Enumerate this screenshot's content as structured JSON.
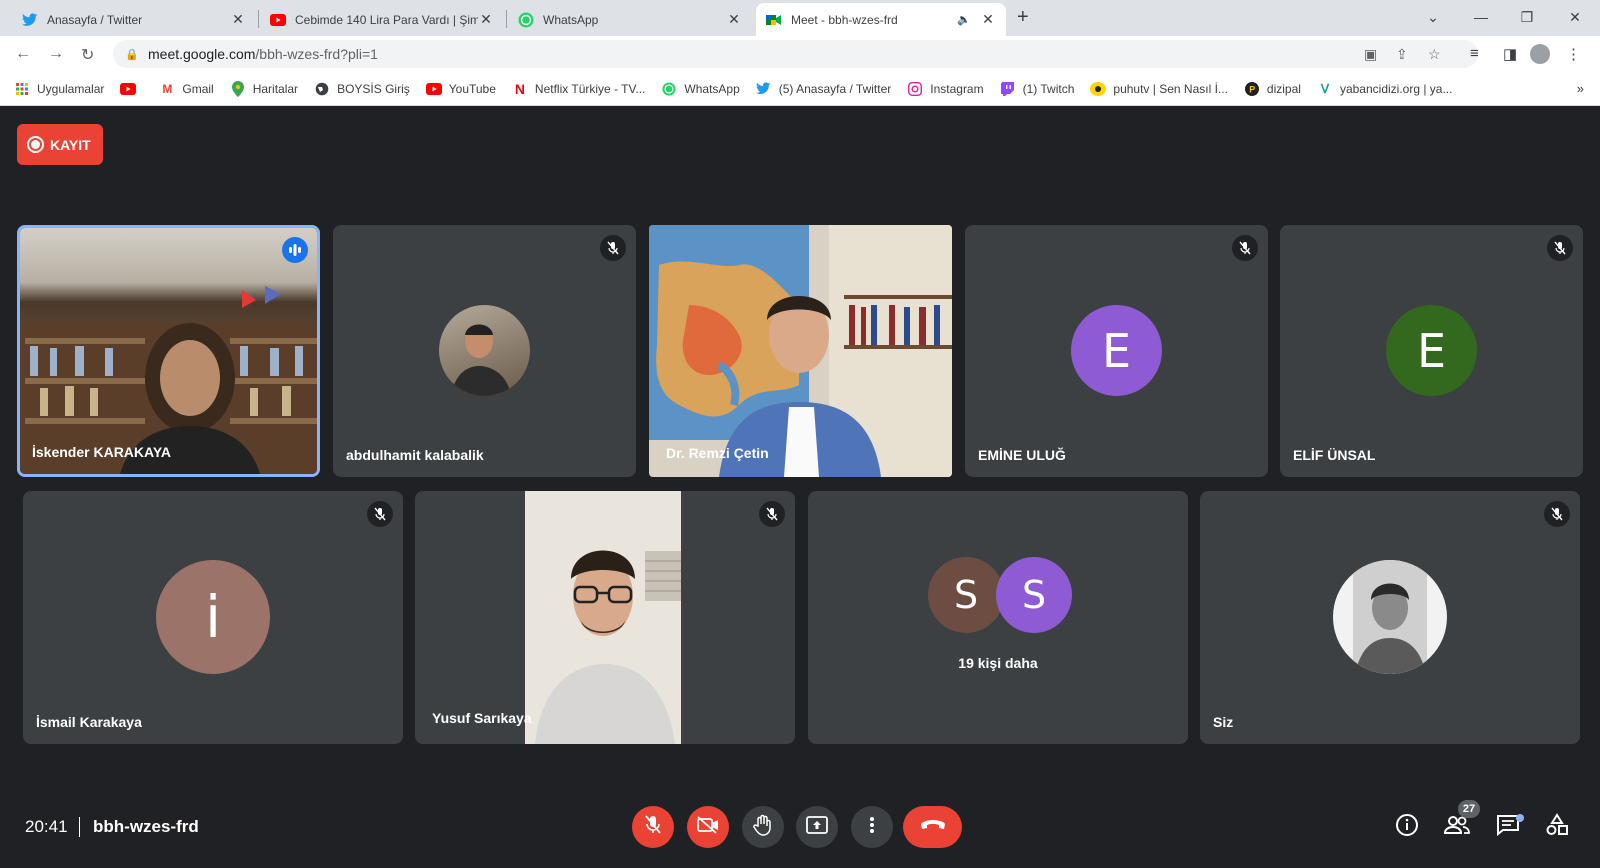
{
  "browser": {
    "tabs": [
      {
        "title": "Anasayfa / Twitter",
        "icon": "twitter-icon",
        "active": false
      },
      {
        "title": "Cebimde 140 Lira Para Vardı | Şim",
        "icon": "youtube-icon",
        "active": false
      },
      {
        "title": "WhatsApp",
        "icon": "whatsapp-icon",
        "active": false
      },
      {
        "title": "Meet - bbh-wzes-frd",
        "icon": "meet-icon",
        "active": true
      }
    ],
    "url_host": "meet.google.com",
    "url_path": "/bbh-wzes-frd?pli=1",
    "bookmarks": [
      {
        "label": "Uygulamalar",
        "icon": "apps-grid-icon"
      },
      {
        "label": "",
        "icon": "youtube-icon"
      },
      {
        "label": "Gmail",
        "icon": "gmail-icon"
      },
      {
        "label": "Haritalar",
        "icon": "maps-pin-icon"
      },
      {
        "label": "BOYSİS Giriş",
        "icon": "globe-icon"
      },
      {
        "label": "YouTube",
        "icon": "youtube-icon"
      },
      {
        "label": "Netflix Türkiye - TV...",
        "icon": "netflix-icon"
      },
      {
        "label": "WhatsApp",
        "icon": "whatsapp-icon"
      },
      {
        "label": "(5) Anasayfa / Twitter",
        "icon": "twitter-icon"
      },
      {
        "label": "Instagram",
        "icon": "instagram-icon"
      },
      {
        "label": "(1) Twitch",
        "icon": "twitch-icon"
      },
      {
        "label": "puhutv | Sen Nasıl İ...",
        "icon": "puhutv-icon"
      },
      {
        "label": "dizipal",
        "icon": "dizipal-icon"
      },
      {
        "label": "yabancidizi.org | ya...",
        "icon": "yabancidizi-icon"
      }
    ],
    "more_bookmarks": "»"
  },
  "meet": {
    "record_label": "KAYIT",
    "participants": [
      {
        "name": "İskender KARAKAYA",
        "type": "video",
        "speaking": true
      },
      {
        "name": "abdulhamit kalabalik",
        "type": "photo-avatar",
        "muted": true
      },
      {
        "name": "Dr. Remzi Çetin",
        "type": "video"
      },
      {
        "name": "EMİNE ULUĞ",
        "type": "letter-avatar",
        "initial": "E",
        "color": "#8e5bd4",
        "muted": true
      },
      {
        "name": "ELİF ÜNSAL",
        "type": "letter-avatar",
        "initial": "E",
        "color": "#33691e",
        "muted": true
      },
      {
        "name": "İsmail Karakaya",
        "type": "letter-avatar",
        "initial": "i",
        "color": "#9c7369",
        "muted": true
      },
      {
        "name": "Yusuf Sarıkaya",
        "type": "video",
        "muted": true
      },
      {
        "name": "Siz",
        "type": "photo-avatar",
        "muted": true
      }
    ],
    "others": {
      "initials": [
        "S",
        "S"
      ],
      "colors": [
        "#6d4c41",
        "#8e5bd4"
      ],
      "label": "19 kişi daha"
    },
    "clock": "20:41",
    "meeting_code": "bbh-wzes-frd",
    "people_count": "27",
    "colors": {
      "accent": "#1a73e8",
      "danger": "#ea4335",
      "tile": "#3c4043",
      "background": "#202124"
    }
  }
}
